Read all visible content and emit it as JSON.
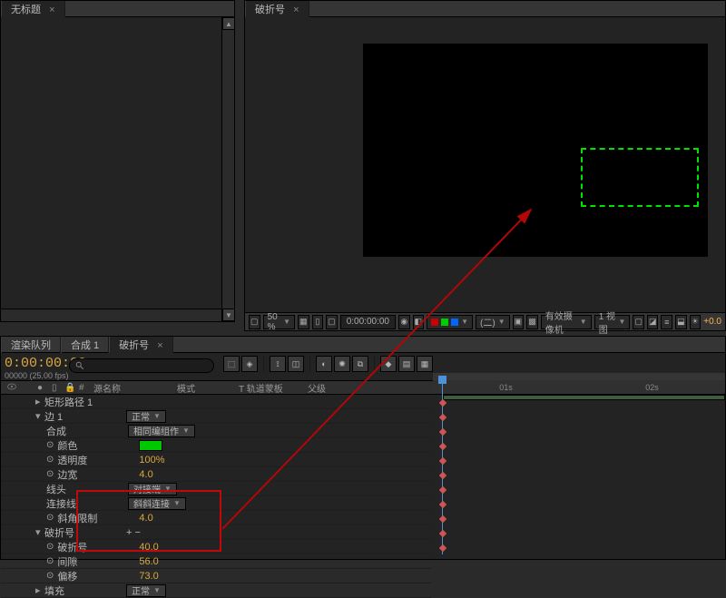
{
  "tabs_left": [
    {
      "label": "无标题"
    }
  ],
  "tabs_view": [
    {
      "label": "破折号"
    }
  ],
  "tabs_time": [
    {
      "label": "渲染队列"
    },
    {
      "label": "合成 1"
    },
    {
      "label": "破折号",
      "active": true
    }
  ],
  "timecode": "0:00:00:00",
  "timecode_sub": "00000 (25.00 fps)",
  "viewer_footer": {
    "zoom": "50 %",
    "tc": "0:00:00:00",
    "res": "(二)",
    "cam": "有效摄像机",
    "views": "1 视图",
    "exposure": "+0.0"
  },
  "col_headers": [
    "源名称",
    "模式",
    "T 轨道蒙板",
    "父级"
  ],
  "ruler": [
    "01s",
    "02s"
  ],
  "tree": {
    "shape_path": "矩形路径 1",
    "edge": "边 1",
    "edge_mode": "正常",
    "composite": {
      "label": "合成",
      "value": "相同编组作"
    },
    "props": [
      {
        "sw": true,
        "name": "颜色",
        "chip": true
      },
      {
        "sw": true,
        "name": "透明度",
        "value": "100%"
      },
      {
        "sw": true,
        "name": "边宽",
        "value": "4.0"
      },
      {
        "sw": false,
        "name": "线头",
        "dropdown": "对接端"
      },
      {
        "sw": false,
        "name": "连接线",
        "dropdown": "斜斜连接"
      },
      {
        "sw": true,
        "name": "斜角限制",
        "value": "4.0"
      }
    ],
    "dash_group": "破折号",
    "dash_plus": "+  −",
    "dash_props": [
      {
        "name": "破折号",
        "value": "40.0"
      },
      {
        "name": "间隙",
        "value": "56.0"
      },
      {
        "name": "偏移",
        "value": "73.0"
      }
    ],
    "fill": {
      "label": "填充",
      "value": "正常"
    }
  }
}
